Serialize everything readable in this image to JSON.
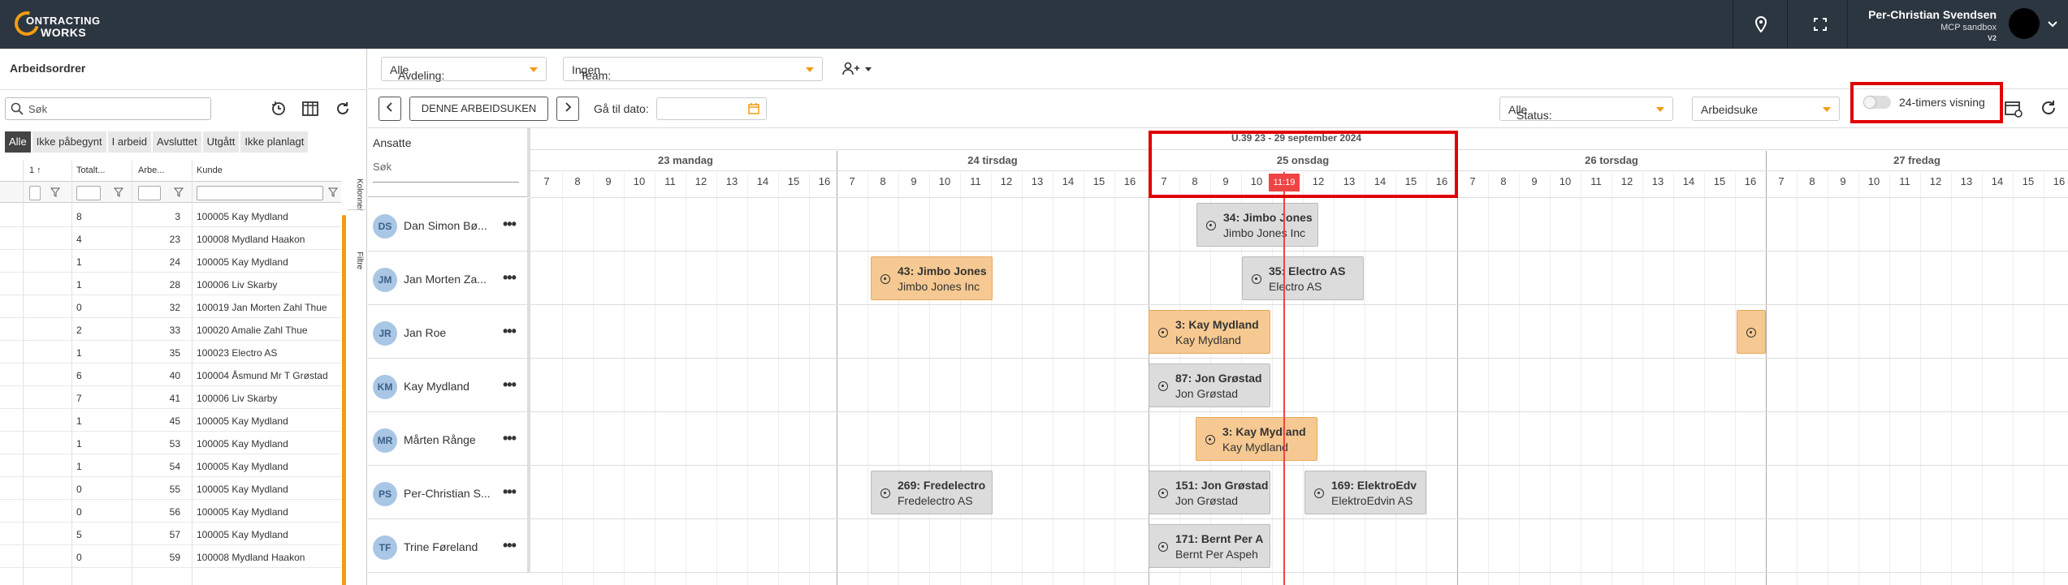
{
  "topbar": {
    "logo_line1": "ONTRACTING",
    "logo_line2": "WORKS",
    "user_name": "Per-Christian Svendsen",
    "user_sub": "MCP sandbox",
    "user_version": "V2"
  },
  "left": {
    "title": "Arbeidsordrer",
    "search_placeholder": "Søk",
    "tabs": [
      "Alle",
      "Ikke påbegynt",
      "I arbeid",
      "Avsluttet",
      "Utgått",
      "Ikke planlagt"
    ],
    "columns": [
      "1 ↑",
      "Totalt...",
      "Arbe...",
      "Kunde"
    ],
    "rows": [
      {
        "a": "8",
        "b": "3",
        "c": "100005 Kay Mydland"
      },
      {
        "a": "4",
        "b": "23",
        "c": "100008 Mydland Haakon"
      },
      {
        "a": "1",
        "b": "24",
        "c": "100005 Kay Mydland"
      },
      {
        "a": "1",
        "b": "28",
        "c": "100006 Liv Skarby"
      },
      {
        "a": "0",
        "b": "32",
        "c": "100019 Jan Morten Zahl Thue"
      },
      {
        "a": "2",
        "b": "33",
        "c": "100020 Amalie Zahl Thue"
      },
      {
        "a": "1",
        "b": "35",
        "c": "100023 Electro AS"
      },
      {
        "a": "6",
        "b": "40",
        "c": "100004 Åsmund Mr T Grøstad"
      },
      {
        "a": "7",
        "b": "41",
        "c": "100006 Liv Skarby"
      },
      {
        "a": "1",
        "b": "45",
        "c": "100005 Kay Mydland"
      },
      {
        "a": "1",
        "b": "53",
        "c": "100005 Kay Mydland"
      },
      {
        "a": "1",
        "b": "54",
        "c": "100005 Kay Mydland"
      },
      {
        "a": "0",
        "b": "55",
        "c": "100005 Kay Mydland"
      },
      {
        "a": "0",
        "b": "56",
        "c": "100005 Kay Mydland"
      },
      {
        "a": "5",
        "b": "57",
        "c": "100005 Kay Mydland"
      },
      {
        "a": "0",
        "b": "59",
        "c": "100008 Mydland Haakon"
      }
    ],
    "side_tab_columns": "Kolonner",
    "side_tab_filters": "Filtre"
  },
  "toolbar": {
    "avdeling_label": "Avdeling:",
    "avdeling_value": "Alle",
    "team_label": "Team:",
    "team_value": "Ingen",
    "this_week_button": "DENNE ARBEIDSUKEN",
    "goto_date_label": "Gå til dato:",
    "status_label": "Status:",
    "status_value": "Alle",
    "view_value": "Arbeidsuke",
    "toggle_label": "24-timers visning",
    "toggle_on": false
  },
  "scheduler": {
    "employees_header": "Ansatte",
    "employee_search": "Søk",
    "week_title": "U.39 23 - 29 september 2024",
    "days": [
      "23 mandag",
      "24 tirsdag",
      "25 onsdag",
      "26 torsdag",
      "27 fredag"
    ],
    "hours": [
      "7",
      "8",
      "9",
      "10",
      "11",
      "12",
      "13",
      "14",
      "15",
      "16"
    ],
    "now_label": "11:19",
    "employees": [
      {
        "initials": "DS",
        "name": "Dan Simon Bø..."
      },
      {
        "initials": "JM",
        "name": "Jan Morten Za..."
      },
      {
        "initials": "JR",
        "name": "Jan Roe"
      },
      {
        "initials": "KM",
        "name": "Kay Mydland"
      },
      {
        "initials": "MR",
        "name": "Mårten Rånge"
      },
      {
        "initials": "PS",
        "name": "Per-Christian S..."
      },
      {
        "initials": "TF",
        "name": "Trine Føreland"
      }
    ],
    "events": [
      {
        "title": "34: Jimbo Jones",
        "sub": "Jimbo Jones Inc",
        "color": "grey"
      },
      {
        "title": "43: Jimbo Jones",
        "sub": "Jimbo Jones Inc",
        "color": "orange"
      },
      {
        "title": "35: Electro AS",
        "sub": "Electro AS",
        "color": "grey"
      },
      {
        "title": "3: Kay Mydland",
        "sub": "Kay Mydland",
        "color": "orange"
      },
      {
        "title": "",
        "sub": "",
        "color": "orange"
      },
      {
        "title": "87: Jon Grøstad",
        "sub": "Jon Grøstad",
        "color": "grey"
      },
      {
        "title": "3: Kay Mydland",
        "sub": "Kay Mydland",
        "color": "orange"
      },
      {
        "title": "269: Fredelectro",
        "sub": "Fredelectro AS",
        "color": "grey"
      },
      {
        "title": "151: Jon Grøstad",
        "sub": "Jon Grøstad",
        "color": "grey"
      },
      {
        "title": "169: ElektroEdv",
        "sub": "ElektroEdvin AS",
        "color": "grey"
      },
      {
        "title": "171: Bernt Per A",
        "sub": "Bernt Per Aspeh",
        "color": "grey"
      }
    ]
  }
}
